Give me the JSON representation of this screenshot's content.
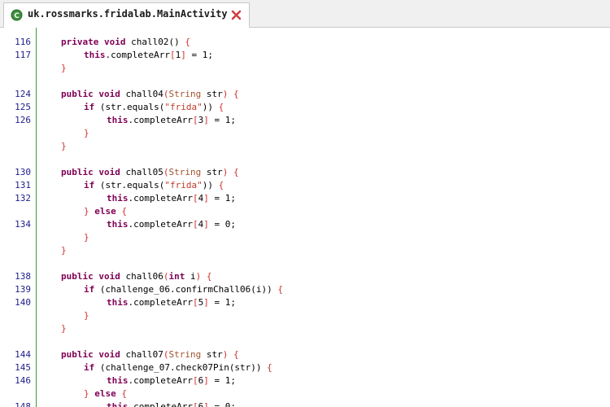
{
  "tab": {
    "title": "uk.rossmarks.fridalab.MainActivity",
    "icon": "class-icon",
    "close_icon": "close-icon"
  },
  "colors": {
    "keyword": "#7f0055",
    "type": "#a0522d",
    "string": "#c0392b",
    "brace": "#d03030",
    "line_number": "#1d1d8a",
    "gutter_border": "#3a9a3a"
  },
  "code_lines": [
    {
      "ln": "116",
      "indent": 1,
      "tokens": [
        [
          "kw",
          "private"
        ],
        [
          "txt",
          " "
        ],
        [
          "kw",
          "void"
        ],
        [
          "txt",
          " chall02() "
        ],
        [
          "brc",
          "{"
        ]
      ]
    },
    {
      "ln": "117",
      "indent": 2,
      "tokens": [
        [
          "kw",
          "this"
        ],
        [
          "txt",
          ".completeArr"
        ],
        [
          "brc",
          "["
        ],
        [
          "txt",
          "1"
        ],
        [
          "brc",
          "]"
        ],
        [
          "txt",
          " = 1;"
        ]
      ]
    },
    {
      "ln": "",
      "indent": 1,
      "tokens": [
        [
          "brc",
          "}"
        ]
      ]
    },
    {
      "ln": "",
      "indent": 0,
      "tokens": []
    },
    {
      "ln": "124",
      "indent": 1,
      "tokens": [
        [
          "kw",
          "public"
        ],
        [
          "txt",
          " "
        ],
        [
          "kw",
          "void"
        ],
        [
          "txt",
          " chall04"
        ],
        [
          "brc",
          "("
        ],
        [
          "type",
          "String"
        ],
        [
          "txt",
          " str"
        ],
        [
          "brc",
          ")"
        ],
        [
          "txt",
          " "
        ],
        [
          "brc",
          "{"
        ]
      ]
    },
    {
      "ln": "125",
      "indent": 2,
      "tokens": [
        [
          "kw",
          "if"
        ],
        [
          "txt",
          " (str.equals("
        ],
        [
          "str",
          "\"frida\""
        ],
        [
          "txt",
          ")) "
        ],
        [
          "brc",
          "{"
        ]
      ]
    },
    {
      "ln": "126",
      "indent": 3,
      "tokens": [
        [
          "kw",
          "this"
        ],
        [
          "txt",
          ".completeArr"
        ],
        [
          "brc",
          "["
        ],
        [
          "txt",
          "3"
        ],
        [
          "brc",
          "]"
        ],
        [
          "txt",
          " = 1;"
        ]
      ]
    },
    {
      "ln": "",
      "indent": 2,
      "tokens": [
        [
          "brc",
          "}"
        ]
      ]
    },
    {
      "ln": "",
      "indent": 1,
      "tokens": [
        [
          "brc",
          "}"
        ]
      ]
    },
    {
      "ln": "",
      "indent": 0,
      "tokens": []
    },
    {
      "ln": "130",
      "indent": 1,
      "tokens": [
        [
          "kw",
          "public"
        ],
        [
          "txt",
          " "
        ],
        [
          "kw",
          "void"
        ],
        [
          "txt",
          " chall05"
        ],
        [
          "brc",
          "("
        ],
        [
          "type",
          "String"
        ],
        [
          "txt",
          " str"
        ],
        [
          "brc",
          ")"
        ],
        [
          "txt",
          " "
        ],
        [
          "brc",
          "{"
        ]
      ]
    },
    {
      "ln": "131",
      "indent": 2,
      "tokens": [
        [
          "kw",
          "if"
        ],
        [
          "txt",
          " (str.equals("
        ],
        [
          "str",
          "\"frida\""
        ],
        [
          "txt",
          ")) "
        ],
        [
          "brc",
          "{"
        ]
      ]
    },
    {
      "ln": "132",
      "indent": 3,
      "tokens": [
        [
          "kw",
          "this"
        ],
        [
          "txt",
          ".completeArr"
        ],
        [
          "brc",
          "["
        ],
        [
          "txt",
          "4"
        ],
        [
          "brc",
          "]"
        ],
        [
          "txt",
          " = 1;"
        ]
      ]
    },
    {
      "ln": "",
      "indent": 2,
      "tokens": [
        [
          "brc",
          "}"
        ],
        [
          "txt",
          " "
        ],
        [
          "kw",
          "else"
        ],
        [
          "txt",
          " "
        ],
        [
          "brc",
          "{"
        ]
      ]
    },
    {
      "ln": "134",
      "indent": 3,
      "tokens": [
        [
          "kw",
          "this"
        ],
        [
          "txt",
          ".completeArr"
        ],
        [
          "brc",
          "["
        ],
        [
          "txt",
          "4"
        ],
        [
          "brc",
          "]"
        ],
        [
          "txt",
          " = 0;"
        ]
      ]
    },
    {
      "ln": "",
      "indent": 2,
      "tokens": [
        [
          "brc",
          "}"
        ]
      ]
    },
    {
      "ln": "",
      "indent": 1,
      "tokens": [
        [
          "brc",
          "}"
        ]
      ]
    },
    {
      "ln": "",
      "indent": 0,
      "tokens": []
    },
    {
      "ln": "138",
      "indent": 1,
      "tokens": [
        [
          "kw",
          "public"
        ],
        [
          "txt",
          " "
        ],
        [
          "kw",
          "void"
        ],
        [
          "txt",
          " chall06"
        ],
        [
          "brc",
          "("
        ],
        [
          "prim",
          "int"
        ],
        [
          "txt",
          " i"
        ],
        [
          "brc",
          ")"
        ],
        [
          "txt",
          " "
        ],
        [
          "brc",
          "{"
        ]
      ]
    },
    {
      "ln": "139",
      "indent": 2,
      "tokens": [
        [
          "kw",
          "if"
        ],
        [
          "txt",
          " (challenge_06.confirmChall06(i)) "
        ],
        [
          "brc",
          "{"
        ]
      ]
    },
    {
      "ln": "140",
      "indent": 3,
      "tokens": [
        [
          "kw",
          "this"
        ],
        [
          "txt",
          ".completeArr"
        ],
        [
          "brc",
          "["
        ],
        [
          "txt",
          "5"
        ],
        [
          "brc",
          "]"
        ],
        [
          "txt",
          " = 1;"
        ]
      ]
    },
    {
      "ln": "",
      "indent": 2,
      "tokens": [
        [
          "brc",
          "}"
        ]
      ]
    },
    {
      "ln": "",
      "indent": 1,
      "tokens": [
        [
          "brc",
          "}"
        ]
      ]
    },
    {
      "ln": "",
      "indent": 0,
      "tokens": []
    },
    {
      "ln": "144",
      "indent": 1,
      "tokens": [
        [
          "kw",
          "public"
        ],
        [
          "txt",
          " "
        ],
        [
          "kw",
          "void"
        ],
        [
          "txt",
          " chall07"
        ],
        [
          "brc",
          "("
        ],
        [
          "type",
          "String"
        ],
        [
          "txt",
          " str"
        ],
        [
          "brc",
          ")"
        ],
        [
          "txt",
          " "
        ],
        [
          "brc",
          "{"
        ]
      ]
    },
    {
      "ln": "145",
      "indent": 2,
      "tokens": [
        [
          "kw",
          "if"
        ],
        [
          "txt",
          " (challenge_07.check07Pin(str)) "
        ],
        [
          "brc",
          "{"
        ]
      ]
    },
    {
      "ln": "146",
      "indent": 3,
      "tokens": [
        [
          "kw",
          "this"
        ],
        [
          "txt",
          ".completeArr"
        ],
        [
          "brc",
          "["
        ],
        [
          "txt",
          "6"
        ],
        [
          "brc",
          "]"
        ],
        [
          "txt",
          " = 1;"
        ]
      ]
    },
    {
      "ln": "",
      "indent": 2,
      "tokens": [
        [
          "brc",
          "}"
        ],
        [
          "txt",
          " "
        ],
        [
          "kw",
          "else"
        ],
        [
          "txt",
          " "
        ],
        [
          "brc",
          "{"
        ]
      ]
    },
    {
      "ln": "148",
      "indent": 3,
      "tokens": [
        [
          "kw",
          "this"
        ],
        [
          "txt",
          ".completeArr"
        ],
        [
          "brc",
          "["
        ],
        [
          "txt",
          "6"
        ],
        [
          "brc",
          "]"
        ],
        [
          "txt",
          " = 0;"
        ]
      ]
    }
  ]
}
